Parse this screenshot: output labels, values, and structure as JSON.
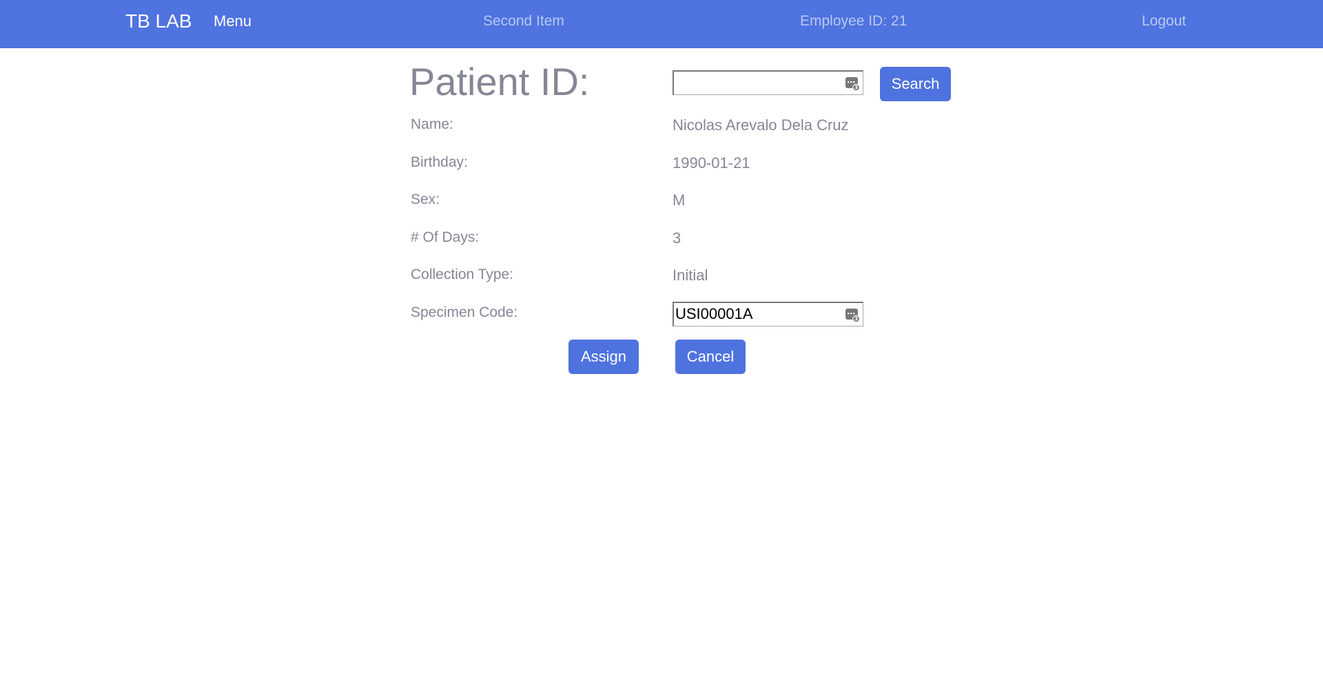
{
  "navbar": {
    "brand": "TB LAB",
    "menu": "Menu",
    "second_item": "Second Item",
    "employee": "Employee ID: 21",
    "logout": "Logout"
  },
  "form": {
    "title": "Patient ID:",
    "patient_id_value": "",
    "search_label": "Search",
    "fields": [
      {
        "label": "Name:",
        "value": "Nicolas Arevalo Dela Cruz"
      },
      {
        "label": "Birthday:",
        "value": "1990-01-21"
      },
      {
        "label": "Sex:",
        "value": "M"
      },
      {
        "label": "# Of Days:",
        "value": "3"
      },
      {
        "label": "Collection Type:",
        "value": "Initial"
      }
    ],
    "specimen_label": "Specimen Code:",
    "specimen_value": "USI00001A",
    "assign_label": "Assign",
    "cancel_label": "Cancel",
    "keyboard_icon": "keyboard-icon",
    "keyboard_badge": "3"
  },
  "colors": {
    "primary": "#4e73df",
    "text_muted": "#858796",
    "nav_inactive": "#b8c9f3"
  }
}
